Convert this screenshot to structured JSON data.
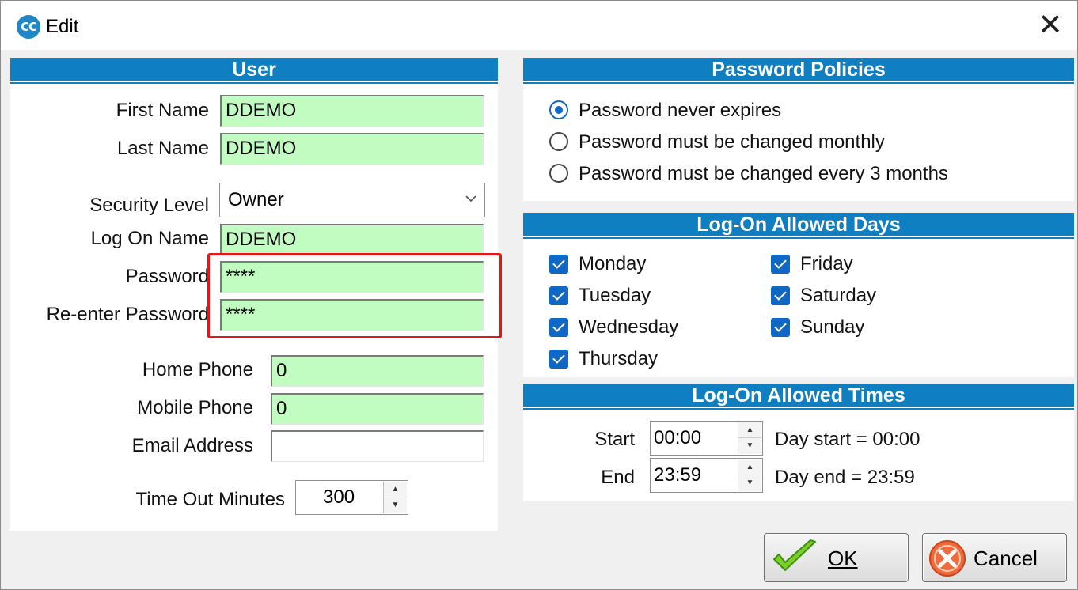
{
  "window": {
    "title": "Edit",
    "app_icon_text": "CC",
    "close_glyph": "✕"
  },
  "user": {
    "header": "User",
    "first_name_label": "First Name",
    "first_name_value": "DDEMO",
    "last_name_label": "Last Name",
    "last_name_value": "DDEMO",
    "security_level_label": "Security Level",
    "security_level_value": "Owner",
    "logon_name_label": "Log On Name",
    "logon_name_value": "DDEMO",
    "password_label": "Password",
    "password_value": "****",
    "reenter_password_label": "Re-enter Password",
    "reenter_password_value": "****",
    "home_phone_label": "Home Phone",
    "home_phone_value": "0",
    "mobile_phone_label": "Mobile Phone",
    "mobile_phone_value": "0",
    "email_label": "Email Address",
    "email_value": "",
    "timeout_label": "Time Out Minutes",
    "timeout_value": "300"
  },
  "password_policies": {
    "header": "Password Policies",
    "options": [
      {
        "label": "Password never expires",
        "selected": true
      },
      {
        "label": "Password must be changed monthly",
        "selected": false
      },
      {
        "label": "Password must be changed every 3 months",
        "selected": false
      }
    ]
  },
  "allowed_days": {
    "header": "Log-On Allowed Days",
    "days": [
      {
        "label": "Monday",
        "checked": true
      },
      {
        "label": "Tuesday",
        "checked": true
      },
      {
        "label": "Wednesday",
        "checked": true
      },
      {
        "label": "Thursday",
        "checked": true
      },
      {
        "label": "Friday",
        "checked": true
      },
      {
        "label": "Saturday",
        "checked": true
      },
      {
        "label": "Sunday",
        "checked": true
      }
    ]
  },
  "allowed_times": {
    "header": "Log-On Allowed Times",
    "start_label": "Start",
    "start_value": "00:00",
    "start_note": "Day start = 00:00",
    "end_label": "End",
    "end_value": "23:59",
    "end_note": "Day end = 23:59"
  },
  "buttons": {
    "ok_label": "OK",
    "cancel_label": "Cancel"
  },
  "colors": {
    "header_blue": "#0f7fc2",
    "field_green": "#c1fdc0",
    "highlight_red": "#e8141b",
    "check_blue": "#0f69c4"
  }
}
